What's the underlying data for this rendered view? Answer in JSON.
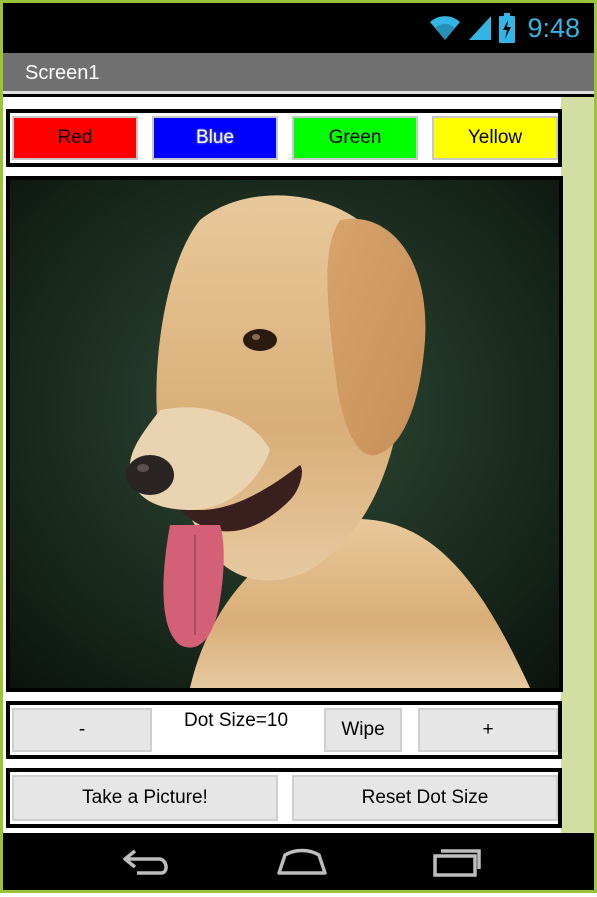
{
  "status_bar": {
    "time": "9:48",
    "icons": [
      "wifi-icon",
      "signal-icon",
      "battery-charging-icon"
    ]
  },
  "title_bar": {
    "title": "Screen1"
  },
  "color_buttons": {
    "red": "Red",
    "blue": "Blue",
    "green": "Green",
    "yellow": "Yellow"
  },
  "canvas": {
    "image": "golden retriever photo"
  },
  "controls": {
    "minus": "-",
    "dot_size": "Dot Size=10",
    "wipe": "Wipe",
    "plus": "+"
  },
  "actions": {
    "take_picture": "Take a Picture!",
    "reset_dot_size": "Reset Dot Size"
  },
  "nav_bar": {
    "icons": [
      "back-icon",
      "home-icon",
      "recent-apps-icon"
    ]
  },
  "colors": {
    "accent": "#33b5e5",
    "title_bar": "#707070",
    "side_strip": "#d2dea2",
    "frame_border": "#9bc33a"
  }
}
